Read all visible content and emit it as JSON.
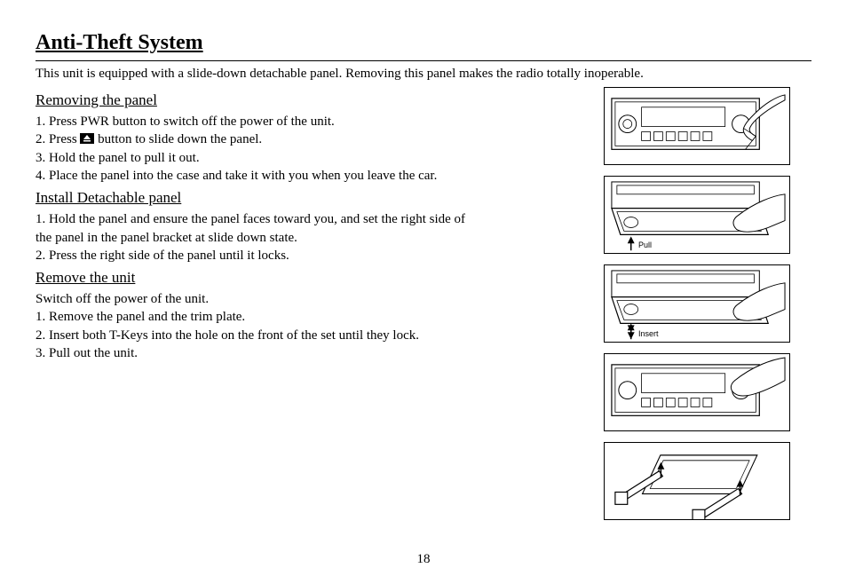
{
  "title": "Anti-Theft System",
  "intro": "This unit is equipped with a slide-down detachable panel. Removing this panel makes the radio totally inoperable.",
  "sections": {
    "removing": {
      "heading": "Removing the panel ",
      "step1": "1.  Press PWR button to switch off the power of the unit.",
      "step2a": "2.  Press ",
      "step2b": " button to slide down the panel.",
      "step3": "3.  Hold the panel to pull it out.",
      "step4": "4.  Place the panel into the case and take it with you when you leave the car."
    },
    "install": {
      "heading": "Install Detachable panel",
      "step1_line1": "1.  Hold the panel and ensure the panel faces toward you, and set the right side of",
      "step1_line2": "the panel in the panel bracket at slide down state.",
      "step2": "2.  Press the right side of the panel until it locks."
    },
    "remove_unit": {
      "heading": "Remove the unit",
      "intro": "Switch off the power of the unit.",
      "step1": "1. Remove the panel and the trim plate.",
      "step2": "2. Insert both T-Keys into the hole on the front of the set until they lock.",
      "step3": "3. Pull out the unit."
    }
  },
  "figures": {
    "fig2_label": "Pull",
    "fig3_label": "Insert"
  },
  "page_number": "18"
}
